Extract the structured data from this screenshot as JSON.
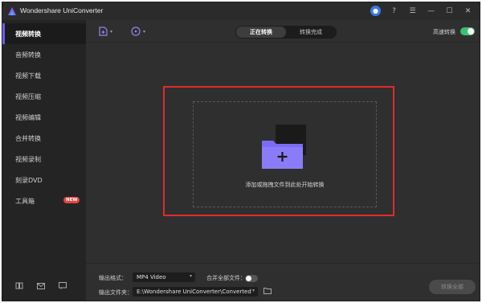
{
  "window": {
    "title": "Wondershare UniConverter"
  },
  "sidebar": {
    "items": [
      {
        "label": "视频转换",
        "active": true
      },
      {
        "label": "音频转换"
      },
      {
        "label": "视频下载"
      },
      {
        "label": "视频压缩"
      },
      {
        "label": "视频编辑"
      },
      {
        "label": "合并转换"
      },
      {
        "label": "视频录制"
      },
      {
        "label": "刻录DVD"
      },
      {
        "label": "工具箱",
        "badge": "NEW"
      }
    ]
  },
  "toolbar": {
    "tabs": [
      {
        "label": "正在转换",
        "active": true
      },
      {
        "label": "转换完成"
      }
    ],
    "high_speed_label": "高速转换",
    "high_speed_on": true
  },
  "drop_zone": {
    "text": "添加或拖拽文件到此处开始转换"
  },
  "footer": {
    "output_format_label": "输出格式：",
    "output_format_value": "MP4 Video",
    "merge_label": "合并全部文件：",
    "merge_on": false,
    "output_folder_label": "输出文件夹：",
    "output_folder_value": "E:\\Wondershare UniConverter\\Converted",
    "start_all_label": "转换全部"
  },
  "colors": {
    "accent": "#6c5cf0",
    "highlight": "#e02b2b",
    "toggle_on": "#38c172",
    "badge": "#e8453c"
  }
}
